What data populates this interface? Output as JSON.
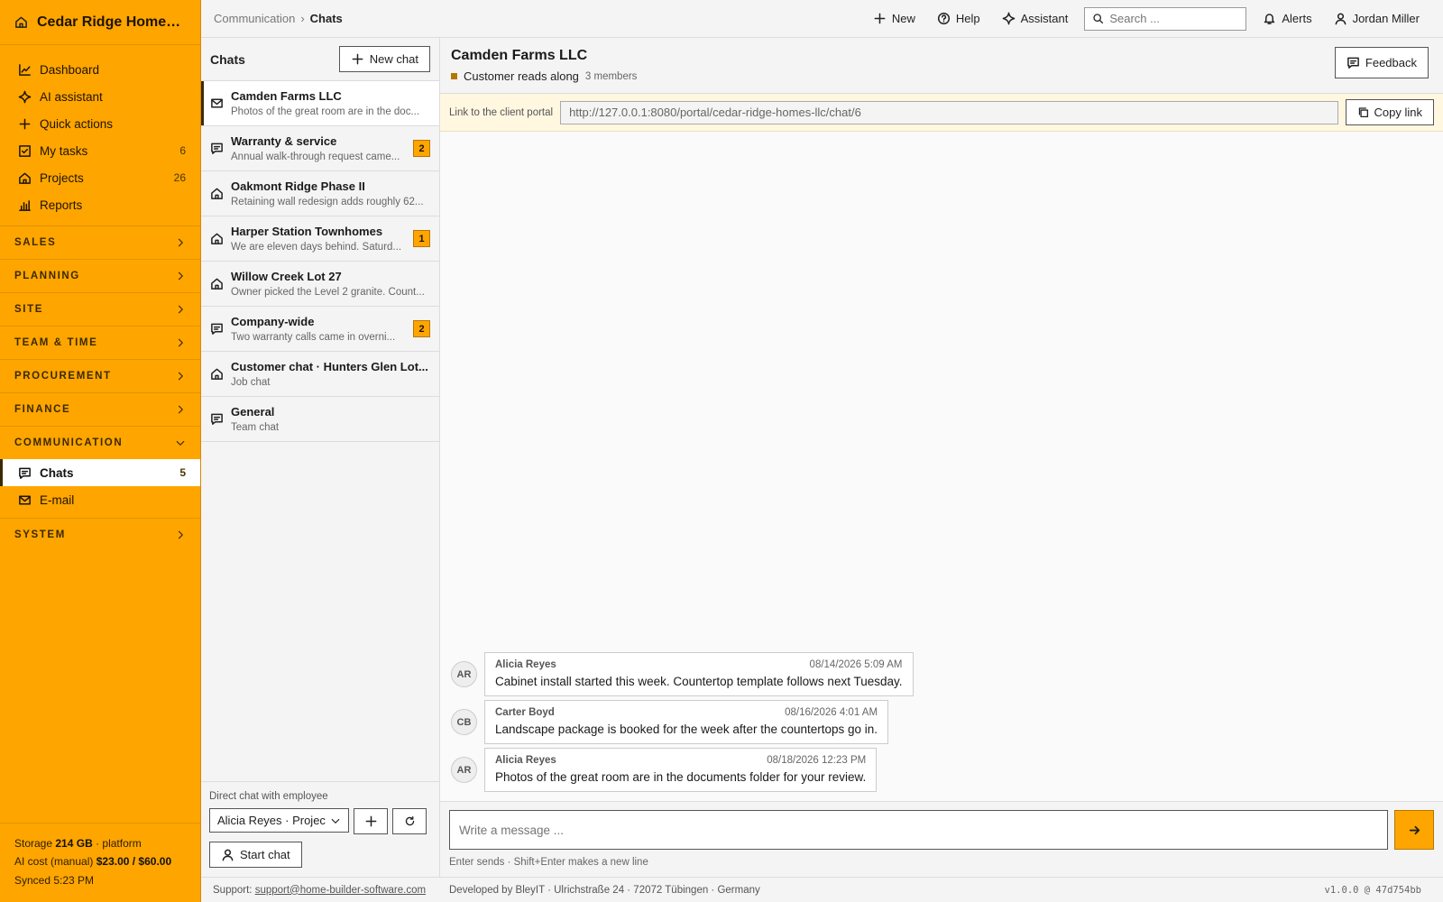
{
  "brand": {
    "title": "Cedar Ridge Homes L..."
  },
  "nav": [
    {
      "label": "Dashboard",
      "icon": "chart-line-icon",
      "count": ""
    },
    {
      "label": "AI assistant",
      "icon": "sparkle-icon",
      "count": ""
    },
    {
      "label": "Quick actions",
      "icon": "plus-icon",
      "count": ""
    },
    {
      "label": "My tasks",
      "icon": "checkbox-icon",
      "count": "6"
    },
    {
      "label": "Projects",
      "icon": "house-icon",
      "count": "26"
    },
    {
      "label": "Reports",
      "icon": "bar-chart-icon",
      "count": ""
    }
  ],
  "sections": {
    "sales": "SALES",
    "planning": "PLANNING",
    "site": "SITE",
    "team_time": "TEAM & TIME",
    "procurement": "PROCUREMENT",
    "finance": "FINANCE",
    "communication": "COMMUNICATION",
    "system": "SYSTEM"
  },
  "comm_items": {
    "chats": {
      "label": "Chats",
      "count": "5"
    },
    "email": {
      "label": "E-mail"
    }
  },
  "sidebar_footer": {
    "storage_label": "Storage",
    "storage_value": "214 GB",
    "storage_suffix": "· platform",
    "ai_label": "AI cost (manual)",
    "ai_value": "$23.00 / $60.00",
    "synced": "Synced 5:23 PM"
  },
  "topbar": {
    "crumb_parent": "Communication",
    "crumb_sep": "›",
    "crumb_current": "Chats",
    "new_label": "New",
    "help_label": "Help",
    "assistant_label": "Assistant",
    "search_placeholder": "Search ...",
    "alerts_label": "Alerts",
    "user_label": "Jordan Miller"
  },
  "chatlist": {
    "title": "Chats",
    "new_chat_label": "New chat",
    "items": [
      {
        "title": "Camden Farms LLC",
        "preview": "Photos of the great room are in the doc...",
        "icon": "mail-icon",
        "badge": ""
      },
      {
        "title": "Warranty & service",
        "preview": "Annual walk-through request came...",
        "icon": "chat-bubble-icon",
        "badge": "2"
      },
      {
        "title": "Oakmont Ridge Phase II",
        "preview": "Retaining wall redesign adds roughly 62...",
        "icon": "house-icon",
        "badge": ""
      },
      {
        "title": "Harper Station Townhomes",
        "preview": "We are eleven days behind. Saturd...",
        "icon": "house-icon",
        "badge": "1"
      },
      {
        "title": "Willow Creek Lot 27",
        "preview": "Owner picked the Level 2 granite. Count...",
        "icon": "house-icon",
        "badge": ""
      },
      {
        "title": "Company-wide",
        "preview": "Two warranty calls came in overni...",
        "icon": "chat-bubble-icon",
        "badge": "2"
      },
      {
        "title": "Customer chat · Hunters Glen Lot...",
        "preview": "Job chat",
        "icon": "house-icon",
        "badge": ""
      },
      {
        "title": "General",
        "preview": "Team chat",
        "icon": "chat-bubble-icon",
        "badge": ""
      }
    ],
    "direct_label": "Direct chat with employee",
    "employee_selected": "Alicia Reyes · Projec",
    "start_chat_label": "Start chat"
  },
  "conversation": {
    "title": "Camden Farms LLC",
    "mode": "Customer reads along",
    "members": "3 members",
    "feedback_label": "Feedback",
    "portal_label": "Link to the client portal",
    "portal_url": "http://127.0.0.1:8080/portal/cedar-ridge-homes-llc/chat/6",
    "copy_link_label": "Copy link",
    "messages": [
      {
        "initials": "AR",
        "author": "Alicia Reyes",
        "time": "08/14/2026 5:09 AM",
        "text": "Cabinet install started this week. Countertop template follows next Tuesday."
      },
      {
        "initials": "CB",
        "author": "Carter Boyd",
        "time": "08/16/2026 4:01 AM",
        "text": "Landscape package is booked for the week after the countertops go in."
      },
      {
        "initials": "AR",
        "author": "Alicia Reyes",
        "time": "08/18/2026 12:23 PM",
        "text": "Photos of the great room are in the documents folder for your review."
      }
    ],
    "composer_placeholder": "Write a message ...",
    "hint": "Enter sends · Shift+Enter makes a new line"
  },
  "footer": {
    "support_label": "Support:",
    "support_email": "support@home-builder-software.com",
    "developer": "Developed by BleyIT · Ulrichstraße 24 · 72072 Tübingen · Germany",
    "version": "v1.0.0 @ 47d754bb"
  },
  "colors": {
    "accent": "#FFA500",
    "accent_dark": "#b57600"
  }
}
